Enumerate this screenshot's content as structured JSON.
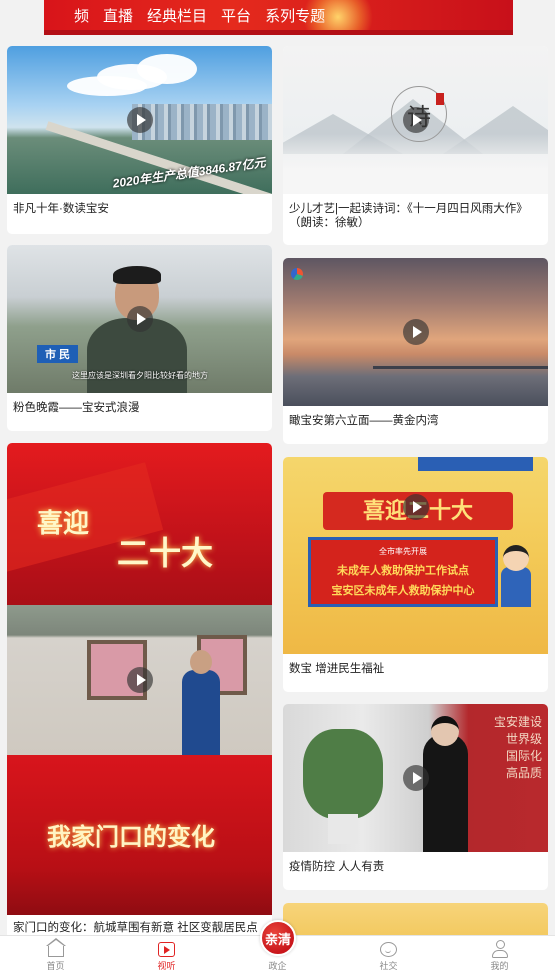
{
  "banner": {
    "nav": [
      "频",
      "直播",
      "经典栏目",
      "平台",
      "系列专题"
    ]
  },
  "left_column": [
    {
      "title": "非凡十年·数读宝安",
      "caption": "2020年生产总值3846.87亿元"
    },
    {
      "title": "粉色晚霞——宝安式浪漫",
      "badge": "市 民",
      "subtitle": "这里应该是深圳看夕阳比较好看的地方"
    },
    {
      "title": "家门口的变化：航城草围有新意 社区变靓居民点赞",
      "text_top_1": "喜迎",
      "text_top_2": "二十大",
      "text_bottom": "我家门口的变化"
    }
  ],
  "right_column": [
    {
      "title": "少儿才艺|一起读诗词：《十一月四日风雨大作》（朗读：徐敏）",
      "seal": "诗"
    },
    {
      "title": "瞰宝安第六立面——黄金内湾"
    },
    {
      "title": "数宝 增进民生福祉",
      "header": "喜迎二十大",
      "line1": "全市率先开展",
      "line2": "未成年人救助保护工作试点",
      "line3": "宝安区未成年人救助保护中心"
    },
    {
      "title": "疫情防控 人人有责",
      "right_text": "宝安建设\n世界级\n国际化\n高品质"
    }
  ],
  "tabbar": {
    "items": [
      {
        "label": "首页",
        "icon": "home-icon",
        "active": false
      },
      {
        "label": "视听",
        "icon": "video-icon",
        "active": true
      },
      {
        "label": "政企",
        "icon": "badge-icon",
        "active": false
      },
      {
        "label": "社交",
        "icon": "chat-icon",
        "active": false
      },
      {
        "label": "我的",
        "icon": "user-icon",
        "active": false
      }
    ],
    "center_badge": "亲清"
  },
  "colors": {
    "accent": "#e02323",
    "background": "#f2f2f2"
  }
}
